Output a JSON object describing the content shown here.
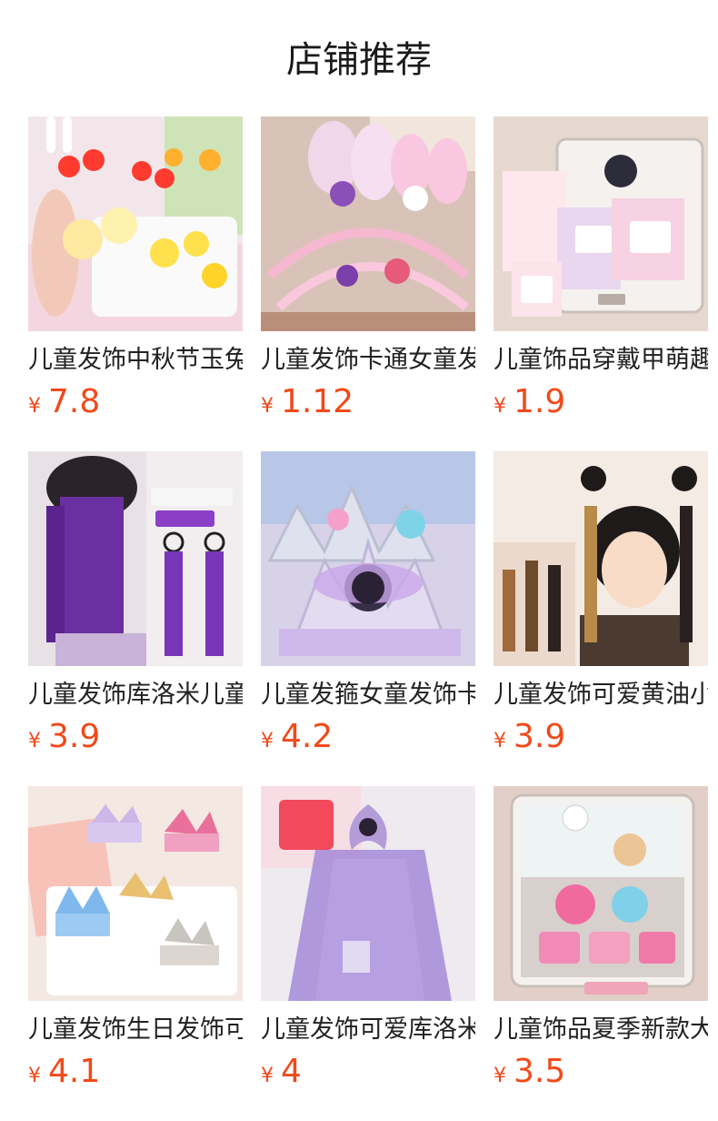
{
  "page": {
    "title": "店铺推荐"
  },
  "currency": "¥",
  "products": [
    {
      "name": "儿童发饰中秋节玉兔发夹",
      "price": "7.8",
      "image": "rabbit-lantern-hairclips"
    },
    {
      "name": "儿童发饰卡通女童发箍",
      "price": "1.12",
      "image": "bunny-ear-headbands"
    },
    {
      "name": "儿童饰品穿戴甲萌趣",
      "price": "1.9",
      "image": "kids-press-on-nails-box"
    },
    {
      "name": "儿童发饰库洛米儿童发辫",
      "price": "3.9",
      "image": "purple-braid-hairpiece"
    },
    {
      "name": "儿童发箍女童发饰卡通皇冠",
      "price": "4.2",
      "image": "princess-crown-tiaras"
    },
    {
      "name": "儿童发饰可爱黄油小熊",
      "price": "3.9",
      "image": "girl-fake-braids"
    },
    {
      "name": "儿童发饰生日发饰可爱皇冠",
      "price": "4.1",
      "image": "birthday-crown-clips"
    },
    {
      "name": "儿童发饰可爱库洛米头纱",
      "price": "4",
      "image": "purple-veil-bow"
    },
    {
      "name": "儿童饰品夏季新款大礼盒",
      "price": "3.5",
      "image": "jewelry-gift-box"
    }
  ]
}
